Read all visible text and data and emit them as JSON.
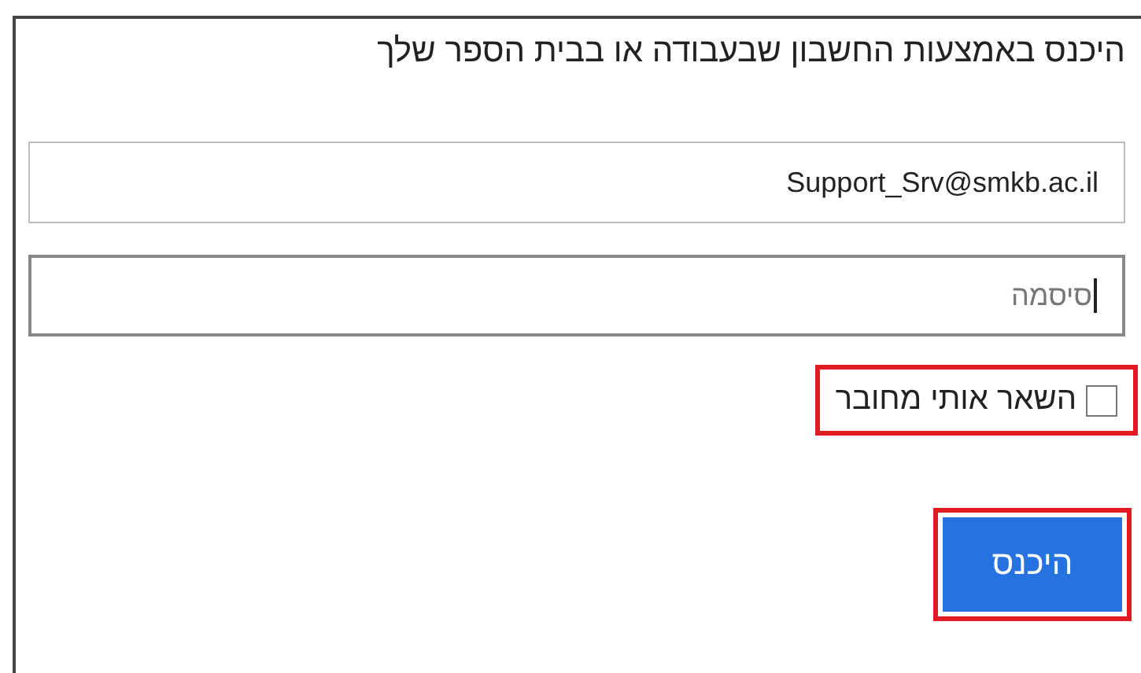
{
  "heading": "היכנס באמצעות החשבון שבעבודה או בבית הספר שלך",
  "email_field": {
    "value": "Support_Srv@smkb.ac.il"
  },
  "password_field": {
    "placeholder": "סיסמה",
    "focused": true
  },
  "keep_signed_in": {
    "label": "השאר אותי מחובר",
    "checked": false,
    "highlighted": true
  },
  "sign_in_button": {
    "label": "היכנס",
    "highlighted": true
  }
}
